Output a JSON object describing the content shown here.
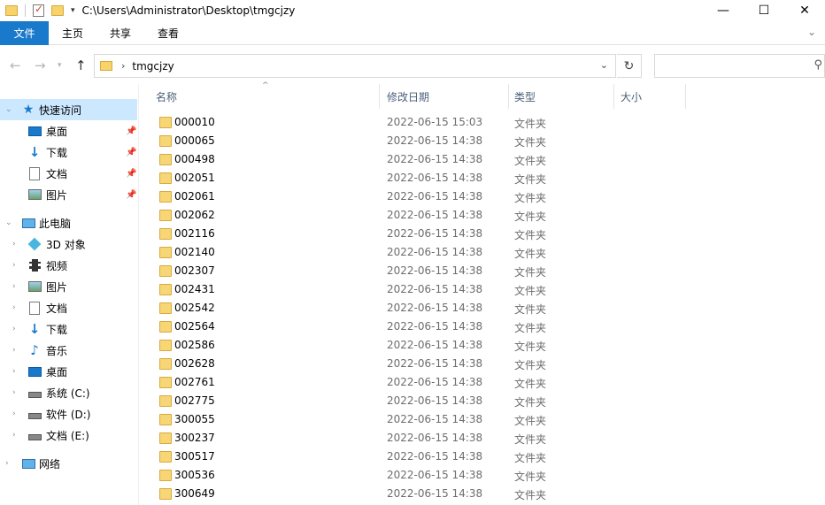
{
  "window": {
    "path_title": "C:\\Users\\Administrator\\Desktop\\tmgcjzy",
    "minimize": "—",
    "maximize": "☐",
    "close": "✕"
  },
  "ribbon": {
    "tabs": [
      "文件",
      "主页",
      "共享",
      "查看"
    ],
    "expand_icon": "chevron-down-icon"
  },
  "address": {
    "current_folder": "tmgcjzy",
    "search_placeholder": ""
  },
  "sidebar": {
    "quick_access": "快速访问",
    "quick_items": [
      {
        "label": "桌面",
        "icon": "desktop-icon",
        "pinned": true
      },
      {
        "label": "下载",
        "icon": "download-icon",
        "pinned": true
      },
      {
        "label": "文档",
        "icon": "document-icon",
        "pinned": true
      },
      {
        "label": "图片",
        "icon": "pictures-icon",
        "pinned": true
      }
    ],
    "this_pc": "此电脑",
    "pc_items": [
      {
        "label": "3D 对象",
        "icon": "3d-objects-icon"
      },
      {
        "label": "视频",
        "icon": "videos-icon"
      },
      {
        "label": "图片",
        "icon": "pictures-icon"
      },
      {
        "label": "文档",
        "icon": "document-icon"
      },
      {
        "label": "下载",
        "icon": "download-icon"
      },
      {
        "label": "音乐",
        "icon": "music-icon"
      },
      {
        "label": "桌面",
        "icon": "desktop-icon"
      },
      {
        "label": "系统 (C:)",
        "icon": "system-drive-icon"
      },
      {
        "label": "软件 (D:)",
        "icon": "drive-icon"
      },
      {
        "label": "文档 (E:)",
        "icon": "drive-icon"
      }
    ],
    "network": "网络"
  },
  "columns": {
    "name": "名称",
    "modified": "修改日期",
    "type": "类型",
    "size": "大小"
  },
  "files": [
    {
      "name": "000010",
      "modified": "2022-06-15 15:03",
      "type": "文件夹"
    },
    {
      "name": "000065",
      "modified": "2022-06-15 14:38",
      "type": "文件夹"
    },
    {
      "name": "000498",
      "modified": "2022-06-15 14:38",
      "type": "文件夹"
    },
    {
      "name": "002051",
      "modified": "2022-06-15 14:38",
      "type": "文件夹"
    },
    {
      "name": "002061",
      "modified": "2022-06-15 14:38",
      "type": "文件夹"
    },
    {
      "name": "002062",
      "modified": "2022-06-15 14:38",
      "type": "文件夹"
    },
    {
      "name": "002116",
      "modified": "2022-06-15 14:38",
      "type": "文件夹"
    },
    {
      "name": "002140",
      "modified": "2022-06-15 14:38",
      "type": "文件夹"
    },
    {
      "name": "002307",
      "modified": "2022-06-15 14:38",
      "type": "文件夹"
    },
    {
      "name": "002431",
      "modified": "2022-06-15 14:38",
      "type": "文件夹"
    },
    {
      "name": "002542",
      "modified": "2022-06-15 14:38",
      "type": "文件夹"
    },
    {
      "name": "002564",
      "modified": "2022-06-15 14:38",
      "type": "文件夹"
    },
    {
      "name": "002586",
      "modified": "2022-06-15 14:38",
      "type": "文件夹"
    },
    {
      "name": "002628",
      "modified": "2022-06-15 14:38",
      "type": "文件夹"
    },
    {
      "name": "002761",
      "modified": "2022-06-15 14:38",
      "type": "文件夹"
    },
    {
      "name": "002775",
      "modified": "2022-06-15 14:38",
      "type": "文件夹"
    },
    {
      "name": "300055",
      "modified": "2022-06-15 14:38",
      "type": "文件夹"
    },
    {
      "name": "300237",
      "modified": "2022-06-15 14:38",
      "type": "文件夹"
    },
    {
      "name": "300517",
      "modified": "2022-06-15 14:38",
      "type": "文件夹"
    },
    {
      "name": "300536",
      "modified": "2022-06-15 14:38",
      "type": "文件夹"
    },
    {
      "name": "300649",
      "modified": "2022-06-15 14:38",
      "type": "文件夹"
    }
  ]
}
